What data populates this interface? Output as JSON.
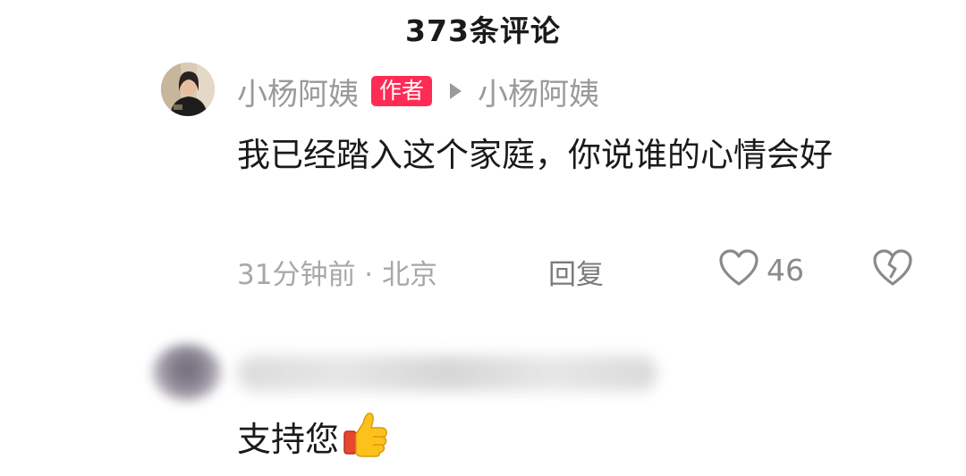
{
  "header": {
    "title": "373条评论"
  },
  "comment": {
    "username": "小杨阿姨",
    "author_badge": "作者",
    "reply_to": "小杨阿姨",
    "text": "我已经踏入这个家庭，你说谁的心情会好",
    "time_location": "31分钟前 · 北京",
    "reply_label": "回复",
    "like_count": "46",
    "like_icon": "heart-outline-icon",
    "dislike_icon": "broken-heart-icon"
  },
  "comment2": {
    "text": "支持您",
    "emoji": "thumbs-up-emoji"
  }
}
